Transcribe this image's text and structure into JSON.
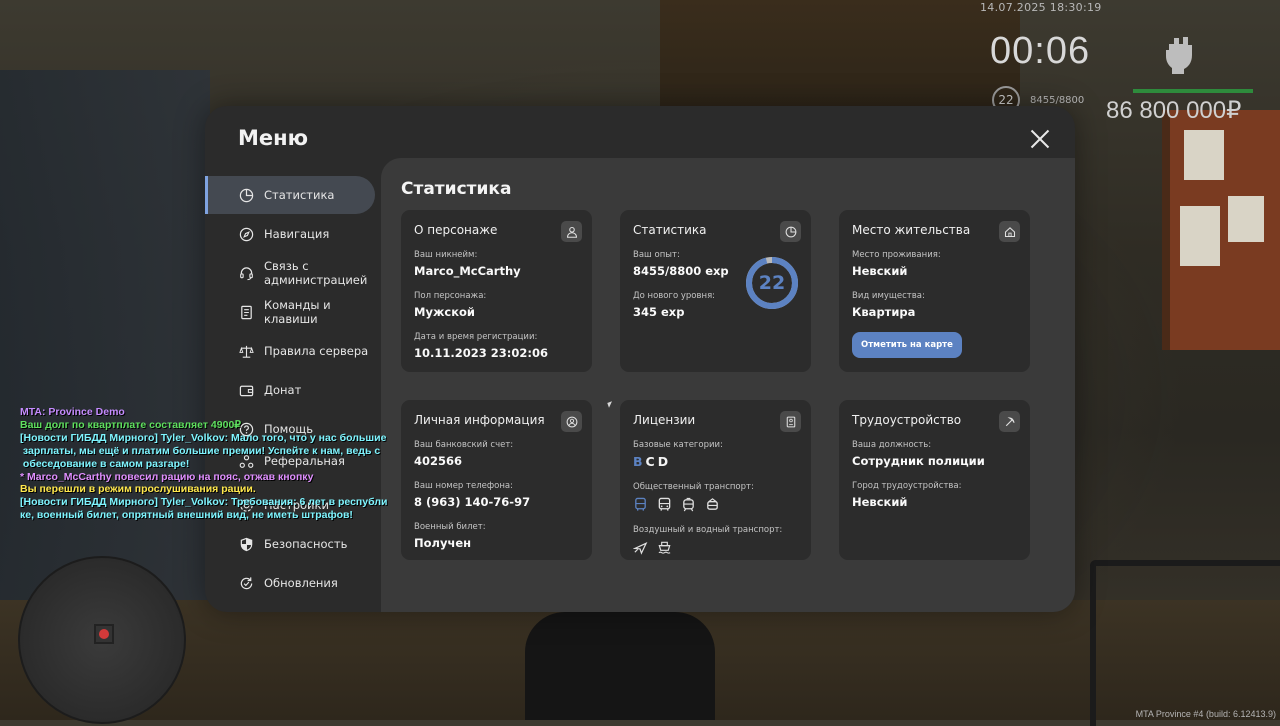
{
  "hud": {
    "datetime": "14.07.2025 18:30:19",
    "timer": "00:06",
    "level": "22",
    "exp": "8455/8800",
    "money": "86 800 000₽"
  },
  "menu": {
    "title": "Меню",
    "nav": [
      {
        "label": "Статистика",
        "icon": "pie-chart-icon",
        "active": true
      },
      {
        "label": "Навигация",
        "icon": "compass-icon"
      },
      {
        "label": "Связь с\nадминистрацией",
        "icon": "headset-icon"
      },
      {
        "label": "Команды и\nклавиши",
        "icon": "document-icon"
      },
      {
        "label": "Правила сервера",
        "icon": "scales-icon"
      },
      {
        "label": "Донат",
        "icon": "wallet-icon"
      },
      {
        "label": "Помощь",
        "icon": "help-icon"
      },
      {
        "label": "Реферальная",
        "icon": "referral-icon"
      },
      {
        "label": "Настройки",
        "icon": "gear-icon"
      },
      {
        "label": "Безопасность",
        "icon": "shield-icon"
      },
      {
        "label": "Обновления",
        "icon": "refresh-icon"
      }
    ]
  },
  "content": {
    "title": "Статистика",
    "character": {
      "title": "О персонаже",
      "nickname_label": "Ваш никнейм:",
      "nickname": "Marco_McCarthy",
      "gender_label": "Пол персонажа:",
      "gender": "Мужской",
      "reg_label": "Дата и время регистрации:",
      "reg": "10.11.2023 23:02:06"
    },
    "stats": {
      "title": "Статистика",
      "exp_label": "Ваш опыт:",
      "exp": "8455/8800 exp",
      "next_label": "До нового уровня:",
      "next": "345 exp",
      "level": "22",
      "progress": 0.96
    },
    "residence": {
      "title": "Место жительства",
      "place_label": "Место проживания:",
      "place": "Невский",
      "property_label": "Вид имущества:",
      "property": "Квартира",
      "map_button": "Отметить на карте"
    },
    "personal": {
      "title": "Личная информация",
      "bank_label": "Ваш банковский счет:",
      "bank": "402566",
      "phone_label": "Ваш номер телефона:",
      "phone": "8 (963) 140-76-97",
      "military_label": "Военный билет:",
      "military": "Получен"
    },
    "licenses": {
      "title": "Лицензии",
      "basic_label": "Базовые категории:",
      "categories": [
        {
          "letter": "B",
          "color": "#5c82c2"
        },
        {
          "letter": "C",
          "color": "#f4f4f4"
        },
        {
          "letter": "D",
          "color": "#f4f4f4"
        }
      ],
      "public_label": "Общественный транспорт:",
      "air_label": "Воздушный и водный транспорт:"
    },
    "job": {
      "title": "Трудоустройство",
      "position_label": "Ваша должность:",
      "position": "Сотрудник полиции",
      "city_label": "Город трудоустройства:",
      "city": "Невский"
    }
  },
  "chat": [
    {
      "text": "MTA: Province Demo",
      "color": "#c58cff"
    },
    {
      "text": "Ваш долг по квартплате составляет 4900₽",
      "color": "#5fe05f"
    },
    {
      "text": "[Новости ГИБДД Мирного] Tyler_Volkov: Мало того, что у нас большие\n зарплаты, мы ещё и платим большие премии! Успейте к нам, ведь с\n обеседование в самом разгаре!",
      "color": "#7ff5ff"
    },
    {
      "text": "* Marco_McCarthy повесил рацию на пояс, отжав кнопку",
      "color": "#e08fff"
    },
    {
      "text": "Вы перешли в режим прослушивания рации.",
      "color": "#ffe84d"
    },
    {
      "text": "[Новости ГИБДД Мирного] Tyler_Volkov: Требования: 6 лет в республи\nке, военный билет, опрятный внешний вид, не иметь штрафов!",
      "color": "#7ff5ff"
    }
  ],
  "footer": "MTA Province #4 (build: 6.12413.9)"
}
